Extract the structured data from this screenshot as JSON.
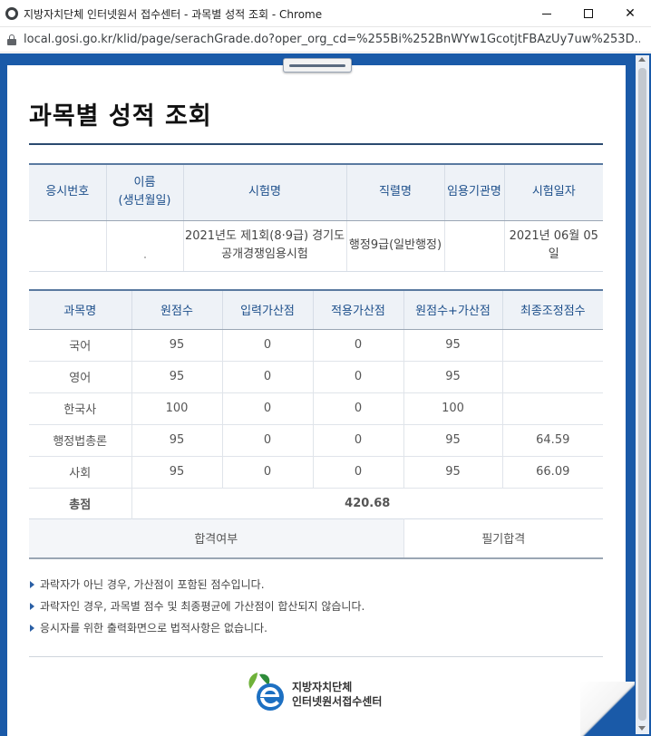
{
  "window": {
    "title": "지방자치단체 인터넷원서 접수센터 - 과목별 성적 조회 - Chrome",
    "minimize_glyph": "",
    "close_glyph": "✕"
  },
  "address_bar": {
    "url": "local.gosi.go.kr/klid/page/serachGrade.do?oper_org_cd=%255Bi%252BnWYw1GcotjtFBAzUy7uw%253D..."
  },
  "page": {
    "title": "과목별 성적 조회"
  },
  "info_table": {
    "headers": [
      "응시번호",
      "이름",
      "(생년월일)",
      "시험명",
      "직렬명",
      "임용기관명",
      "시험일자"
    ],
    "row": {
      "exam_number": "",
      "name": "",
      "exam_name_line1": "2021년도 제1회(8·9급) 경기도",
      "exam_name_line2": "공개경쟁임용시험",
      "series": "행정9급(일반행정)",
      "agency": "",
      "exam_date": "2021년 06월 05일"
    }
  },
  "score_table": {
    "headers": [
      "과목명",
      "원점수",
      "입력가산점",
      "적용가산점",
      "원점수+가산점",
      "최종조정점수"
    ],
    "rows": [
      {
        "subject": "국어",
        "raw": "95",
        "input_bonus": "0",
        "applied_bonus": "0",
        "raw_plus_bonus": "95",
        "final": ""
      },
      {
        "subject": "영어",
        "raw": "95",
        "input_bonus": "0",
        "applied_bonus": "0",
        "raw_plus_bonus": "95",
        "final": ""
      },
      {
        "subject": "한국사",
        "raw": "100",
        "input_bonus": "0",
        "applied_bonus": "0",
        "raw_plus_bonus": "100",
        "final": ""
      },
      {
        "subject": "행정법총론",
        "raw": "95",
        "input_bonus": "0",
        "applied_bonus": "0",
        "raw_plus_bonus": "95",
        "final": "64.59"
      },
      {
        "subject": "사회",
        "raw": "95",
        "input_bonus": "0",
        "applied_bonus": "0",
        "raw_plus_bonus": "95",
        "final": "66.09"
      }
    ],
    "total_label": "총점",
    "total_value": "420.68",
    "pass_label": "합격여부",
    "pass_value": "필기합격"
  },
  "notes": [
    "과락자가 아닌 경우, 가산점이 포함된 점수입니다.",
    "과락자인 경우, 과목별 점수 및 최종평균에 가산점이 합산되지 않습니다.",
    "응시자를 위한 출력화면으로 법적사항은 없습니다."
  ],
  "footer": {
    "logo_line1": "지방자치단체",
    "logo_line2": "인터넷원서접수센터"
  },
  "colors": {
    "frame_blue": "#1a5aa8",
    "header_text": "#1d4f8b",
    "pass_value_color": "#a0581a"
  }
}
